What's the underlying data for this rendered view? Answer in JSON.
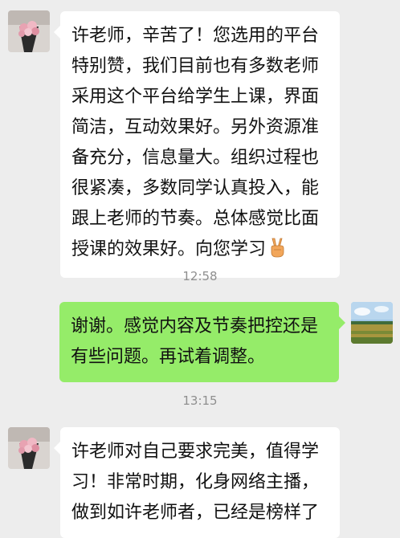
{
  "messages": [
    {
      "text": "许老师，辛苦了！您选用的平台特别赞，我们目前也有多数老师采用这个平台给学生上课，界面简洁，互动效果好。另外资源准备充分，信息量大。组织过程也很紧凑，多数同学认真投入，能跟上老师的节奏。总体感觉比面授课的效果好。向您学习",
      "emoji": "victory-hand-icon"
    },
    {
      "time": "12:58"
    },
    {
      "text": "谢谢。感觉内容及节奏把控还是有些问题。再试着调整。"
    },
    {
      "time": "13:15"
    },
    {
      "text": "许老师对自己要求完美，值得学习！非常时期，化身网络主播，做到如许老师者，已经是榜样了"
    }
  ],
  "colors": {
    "background": "#ededed",
    "incoming_bubble": "#ffffff",
    "outgoing_bubble": "#95ec69",
    "timestamp": "#8f8f8f"
  }
}
